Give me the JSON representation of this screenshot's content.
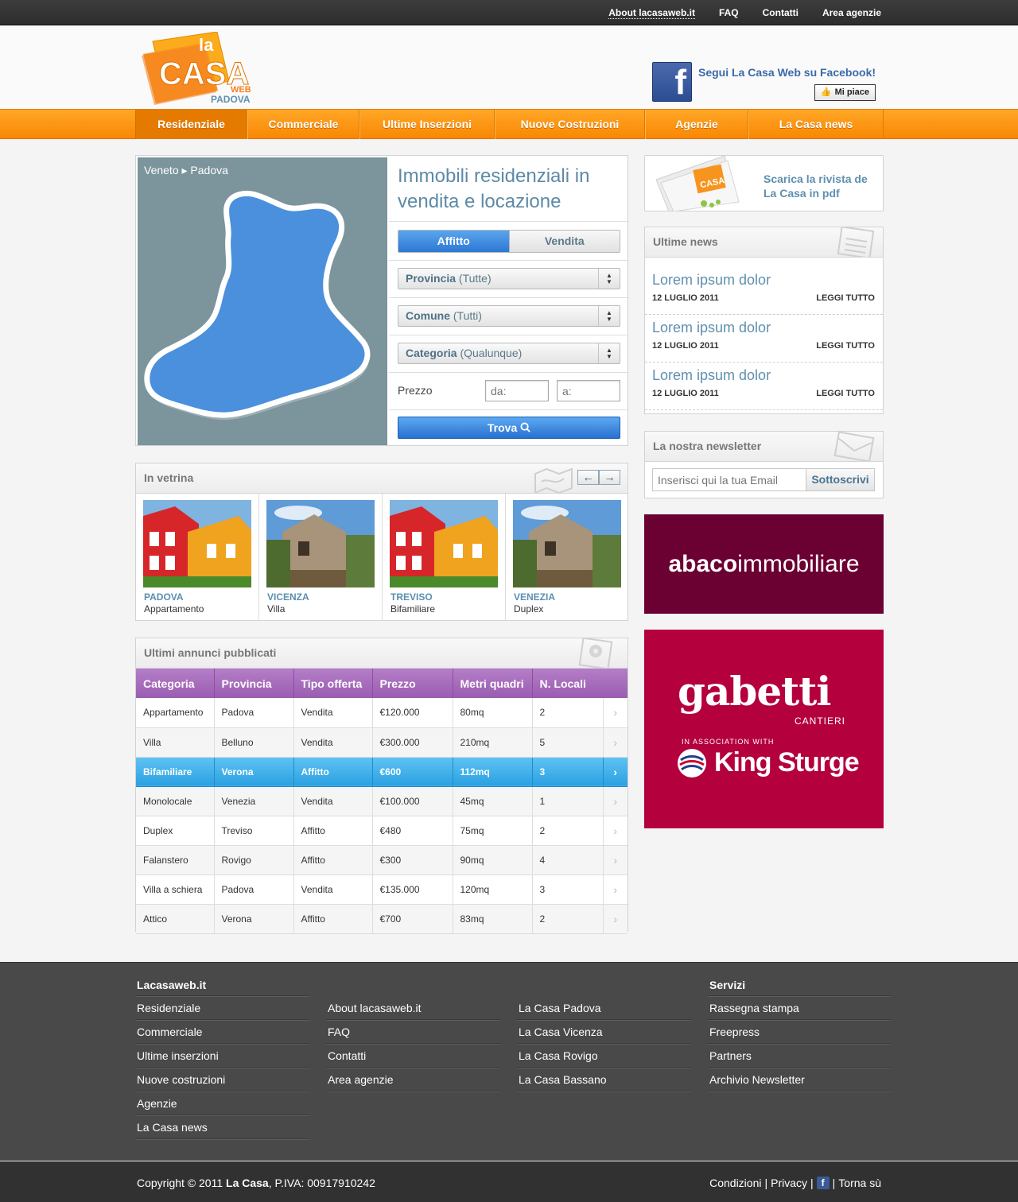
{
  "topbar": {
    "links": [
      "About lacasaweb.it",
      "FAQ",
      "Contatti",
      "Area agenzie"
    ]
  },
  "header": {
    "logo_la": "la",
    "logo_casa": "CASA",
    "logo_web": "WEB",
    "logo_city": "PADOVA",
    "facebook_text": "Segui La Casa Web su Facebook!",
    "like_label": "Mi piace"
  },
  "nav": {
    "items": [
      "Residenziale",
      "Commerciale",
      "Ultime Inserzioni",
      "Nuove Costruzioni",
      "Agenzie",
      "La Casa news"
    ],
    "active": "Residenziale"
  },
  "search": {
    "breadcrumb": "Veneto ▸ Padova",
    "title": "Immobili residenziali in vendita e locazione",
    "tab_affitto": "Affitto",
    "tab_vendita": "Vendita",
    "provincia_label": "Provincia",
    "provincia_value": "(Tutte)",
    "comune_label": "Comune",
    "comune_value": "(Tutti)",
    "categoria_label": "Categoria",
    "categoria_value": "(Qualunque)",
    "prezzo_label": "Prezzo",
    "da_placeholder": "da:",
    "a_placeholder": "a:",
    "trova_label": "Trova"
  },
  "vetrina": {
    "title": "In vetrina",
    "prev": "←",
    "next": "→",
    "items": [
      {
        "city": "PADOVA",
        "type": "Appartamento",
        "image": "red-yellow-houses"
      },
      {
        "city": "VICENZA",
        "type": "Villa",
        "image": "stone-villa"
      },
      {
        "city": "TREVISO",
        "type": "Bifamiliare",
        "image": "red-yellow-houses"
      },
      {
        "city": "VENEZIA",
        "type": "Duplex",
        "image": "stone-villa"
      }
    ]
  },
  "annunci": {
    "title": "Ultimi annunci pubblicati",
    "columns": [
      "Categoria",
      "Provincia",
      "Tipo offerta",
      "Prezzo",
      "Metri quadri",
      "N. Locali"
    ],
    "rows": [
      [
        "Appartamento",
        "Padova",
        "Vendita",
        "€120.000",
        "80mq",
        "2"
      ],
      [
        "Villa",
        "Belluno",
        "Vendita",
        "€300.000",
        "210mq",
        "5"
      ],
      [
        "Bifamiliare",
        "Verona",
        "Affitto",
        "€600",
        "112mq",
        "3"
      ],
      [
        "Monolocale",
        "Venezia",
        "Vendita",
        "€100.000",
        "45mq",
        "1"
      ],
      [
        "Duplex",
        "Treviso",
        "Affitto",
        "€480",
        "75mq",
        "2"
      ],
      [
        "Falanstero",
        "Rovigo",
        "Affitto",
        "€300",
        "90mq",
        "4"
      ],
      [
        "Villa a schiera",
        "Padova",
        "Vendita",
        "€135.000",
        "120mq",
        "3"
      ],
      [
        "Attico",
        "Verona",
        "Affitto",
        "€700",
        "83mq",
        "2"
      ]
    ],
    "selected_row": 2
  },
  "rivista": {
    "line1": "Scarica la rivista de",
    "line2": "La Casa in pdf"
  },
  "news": {
    "title": "Ultime news",
    "items": [
      {
        "title": "Lorem ipsum dolor",
        "date": "12 LUGLIO 2011",
        "link": "LEGGI TUTTO"
      },
      {
        "title": "Lorem ipsum dolor",
        "date": "12 LUGLIO 2011",
        "link": "LEGGI TUTTO"
      },
      {
        "title": "Lorem ipsum dolor",
        "date": "12 LUGLIO 2011",
        "link": "LEGGI TUTTO"
      }
    ]
  },
  "newsletter": {
    "title": "La nostra newsletter",
    "placeholder": "Inserisci qui la tua Email",
    "button": "Sottoscrivi"
  },
  "ads": {
    "abaco_bold": "abaco",
    "abaco_light": "immobiliare",
    "gabetti_name": "gabetti",
    "gabetti_sub": "CANTIERI",
    "gabetti_assoc": "IN ASSOCIATION WITH",
    "gabetti_partner": "King Sturge"
  },
  "footer": {
    "col1": {
      "title": "Lacasaweb.it",
      "items": [
        "Residenziale",
        "Commerciale",
        "Ultime inserzioni",
        "Nuove costruzioni",
        "Agenzie",
        "La Casa news"
      ]
    },
    "col2": {
      "title": "",
      "items": [
        "About lacasaweb.it",
        "FAQ",
        "Contatti",
        "Area agenzie"
      ]
    },
    "col3": {
      "title": "",
      "items": [
        "La Casa Padova",
        "La Casa  Vicenza",
        "La Casa Rovigo",
        "La Casa Bassano"
      ]
    },
    "col4": {
      "title": "Servizi",
      "items": [
        "Rassegna stampa",
        "Freepress",
        "Partners",
        "Archivio Newsletter"
      ]
    },
    "copyright_prefix": "Copyright © 2011 ",
    "copyright_brand": "La Casa",
    "copyright_suffix": ", P.IVA: 00917910242",
    "condizioni": "Condizioni",
    "privacy": "Privacy",
    "torna": "Torna sù",
    "sep": "|"
  },
  "colors": {
    "orange": "#f98704",
    "accent_blue": "#5f8fb0",
    "table_purple": "#9a5db1",
    "selected_blue": "#2aa0e2"
  }
}
